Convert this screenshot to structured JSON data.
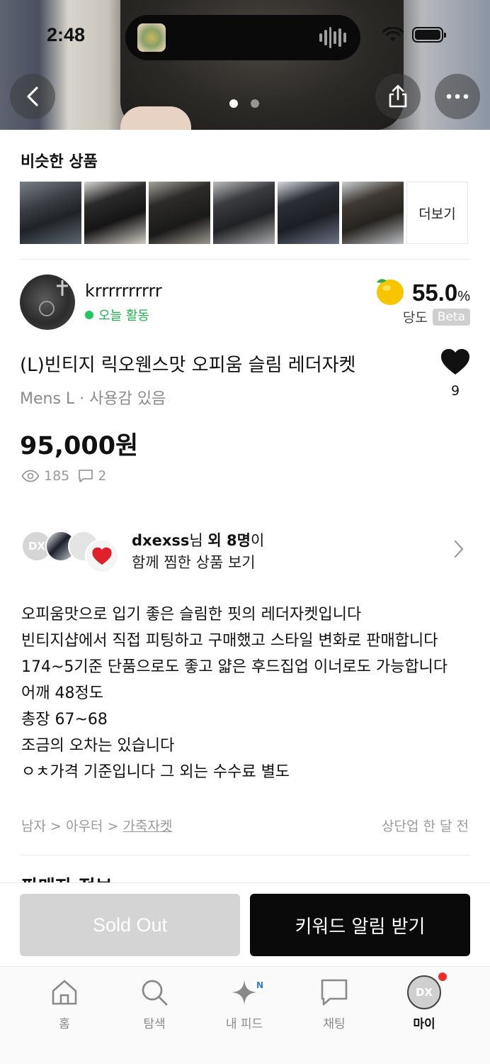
{
  "status_bar": {
    "time": "2:48"
  },
  "hero": {
    "page_count": 2,
    "active_page": 1
  },
  "similar": {
    "title": "비슷한 상품",
    "thumbs": [
      "jacket-1",
      "jacket-2",
      "jacket-3",
      "jacket-4",
      "jacket-5",
      "jacket-6"
    ],
    "more_label": "더보기"
  },
  "seller": {
    "name": "krrrrrrrrrr",
    "activity": "오늘 활동",
    "sweetness_value": "55.0",
    "sweetness_unit": "%",
    "sweetness_label": "당도",
    "beta_label": "Beta"
  },
  "product": {
    "title": "(L)빈티지 릭오웬스맛 오피움 슬림 레더자켓",
    "meta": "Mens L · 사용감 있음",
    "price": "95,000원",
    "likes": "9",
    "views": "185",
    "comments": "2"
  },
  "liked_together": {
    "avatar_label": "DX",
    "user": "dxexss",
    "suffix_1": "님 ",
    "others": "외 8명",
    "suffix_2": "이",
    "line2": "함께 찜한 상품 보기"
  },
  "description": [
    "오피움맛으로 입기 좋은 슬림한 핏의 레더자켓입니다",
    "빈티지샵에서 직접 피팅하고 구매했고 스타일 변화로 판매합니다",
    "174~5기준 단품으로도 좋고 얇은 후드집업 이너로도 가능합니다",
    "어깨 48정도",
    "총장 67~68",
    "조금의 오차는 있습니다",
    "ㅇㅊ가격 기준입니다 그 외는 수수료 별도"
  ],
  "category": {
    "crumb_1": "남자",
    "sep": " > ",
    "crumb_2": "아우터",
    "crumb_3": "가죽자켓",
    "posted": "상단업 한 달 전"
  },
  "next_section_title": "판매자 정보",
  "actions": {
    "sold_out": "Sold Out",
    "keyword_alert": "키워드 알림 받기"
  },
  "tabs": {
    "home": "홈",
    "search": "탐색",
    "feed": "내 피드",
    "feed_badge": "N",
    "chat": "채팅",
    "my": "마이",
    "my_avatar": "DX"
  },
  "colors": {
    "accent_green": "#22c55e",
    "sold_out_bg": "#d4d4d4",
    "primary_button": "#0a0a0a",
    "badge_red": "#ef2b2b"
  }
}
